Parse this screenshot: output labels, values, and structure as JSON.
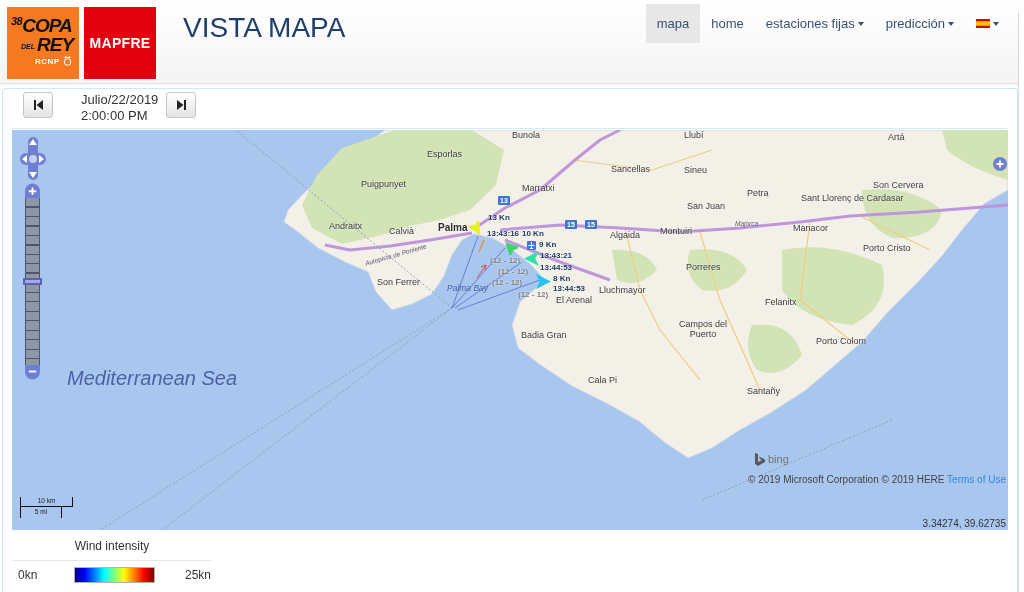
{
  "header": {
    "event_logo": {
      "edition": "38",
      "top": "COPA",
      "small": "DEL",
      "bottom": "REY",
      "club": "RCNP"
    },
    "sponsor_logo": "MAPFRE",
    "title": "VISTA MAPA"
  },
  "nav": [
    {
      "label": "mapa",
      "kind": "link",
      "selected": true
    },
    {
      "label": "home",
      "kind": "link",
      "selected": false
    },
    {
      "label": "estaciones fijas",
      "kind": "dropdown",
      "selected": false
    },
    {
      "label": "predicción",
      "kind": "dropdown",
      "selected": false
    },
    {
      "kind": "language",
      "selected": false
    }
  ],
  "date_bar": {
    "date": "Julio/22/2019",
    "time": "2:00:00 PM"
  },
  "map": {
    "places": [
      {
        "name": "Bunola",
        "kind": "town"
      },
      {
        "name": "Llubí",
        "kind": "town"
      },
      {
        "name": "Artá",
        "kind": "town"
      },
      {
        "name": "Esporlas",
        "kind": "town"
      },
      {
        "name": "Sancellas",
        "kind": "town"
      },
      {
        "name": "Sineu",
        "kind": "town"
      },
      {
        "name": "Puigpunyet",
        "kind": "town"
      },
      {
        "name": "Marratxi",
        "kind": "town"
      },
      {
        "name": "Son Cervera",
        "kind": "town"
      },
      {
        "name": "Petra",
        "kind": "town"
      },
      {
        "name": "Sant Llorenç de Cardasar",
        "kind": "town"
      },
      {
        "name": "San Juan",
        "kind": "town"
      },
      {
        "name": "Andraitx",
        "kind": "town"
      },
      {
        "name": "Calvià",
        "kind": "town"
      },
      {
        "name": "Montuiri",
        "kind": "town"
      },
      {
        "name": "Manacor",
        "kind": "town"
      },
      {
        "name": "Algaida",
        "kind": "town"
      },
      {
        "name": "Porto Cristo",
        "kind": "town"
      },
      {
        "name": "Porreres",
        "kind": "town"
      },
      {
        "name": "Son Ferrer",
        "kind": "town"
      },
      {
        "name": "Lluchmayor",
        "kind": "town"
      },
      {
        "name": "Felanitx",
        "kind": "town"
      },
      {
        "name": "Badia Gran",
        "kind": "town"
      },
      {
        "name": "Campos del Puerto",
        "kind": "town"
      },
      {
        "name": "Porto Colom",
        "kind": "town"
      },
      {
        "name": "Cala Pi",
        "kind": "town"
      },
      {
        "name": "Santañy",
        "kind": "town"
      },
      {
        "name": "Palma",
        "kind": "city"
      },
      {
        "name": "El Arenal",
        "kind": "town"
      },
      {
        "name": "Palma Bay",
        "kind": "water"
      },
      {
        "name": "Mediterranean Sea",
        "kind": "sea"
      },
      {
        "name": "Majorca",
        "kind": "road"
      },
      {
        "name": "Autopista de Poniente",
        "kind": "road"
      }
    ],
    "road_shields": [
      "13",
      "15",
      "15"
    ],
    "boats": [
      {
        "color": "#e8f21e",
        "speed": "13 Kn",
        "time": "13:43:16",
        "range": "(12 - 12)"
      },
      {
        "color": "#3fd46a",
        "speed": "10 Kn",
        "time": "13:43:21",
        "range": "(12 - 12)"
      },
      {
        "color": "#2fe0a8",
        "speed": "9 Kn",
        "time": "13:44:53",
        "range": "(12 - 12)"
      },
      {
        "color": "#22c4f2",
        "speed": "8 Kn",
        "time": "13:44:53",
        "range": "(12 - 12)"
      }
    ],
    "zoom": {
      "level": 0.5
    },
    "scale": {
      "metric": "10 km",
      "imperial": "5 mi"
    },
    "logo_text": "bing",
    "attribution": {
      "text": "© 2019 Microsoft Corporation © 2019 HERE",
      "link": "Terms of Use"
    },
    "coordinates": "3.34274, 39.62735"
  },
  "legend": {
    "title": "Wind intensity",
    "min": "0kn",
    "max": "25kn"
  }
}
